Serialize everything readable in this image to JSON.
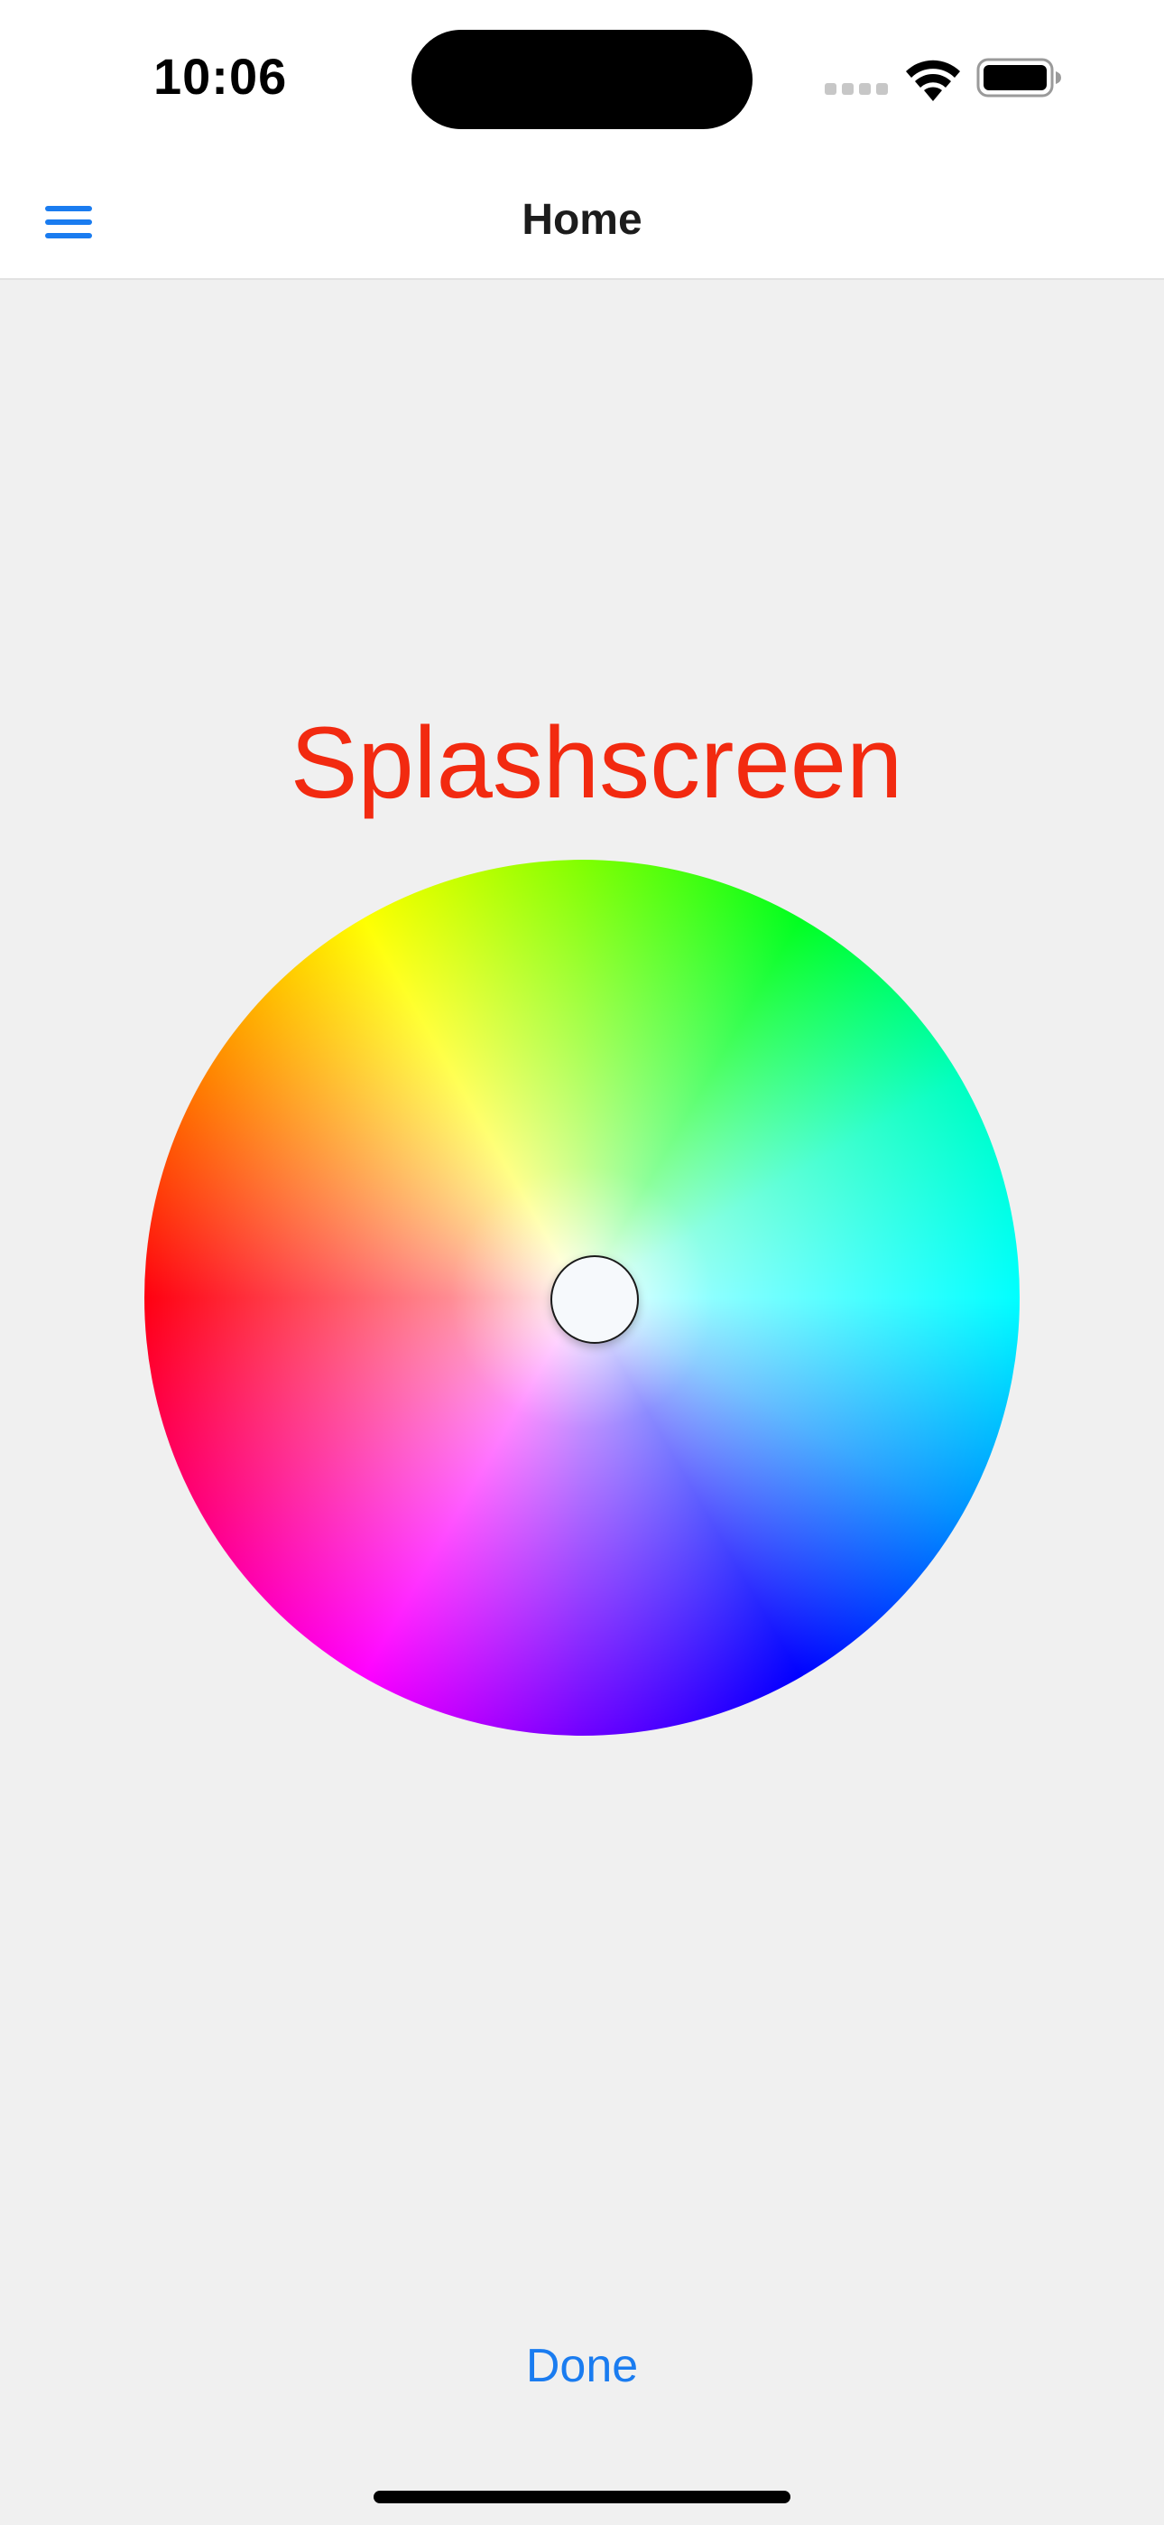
{
  "status_bar": {
    "time": "10:06"
  },
  "nav": {
    "title": "Home",
    "menu_icon": "hamburger-menu-icon"
  },
  "content": {
    "splash_title": "Splashscreen",
    "splash_color": "#f22a10",
    "knob_color": "#f6f9fc"
  },
  "footer": {
    "done_label": "Done"
  },
  "colors": {
    "accent": "#1a7cf0",
    "background": "#f0f0f0"
  }
}
